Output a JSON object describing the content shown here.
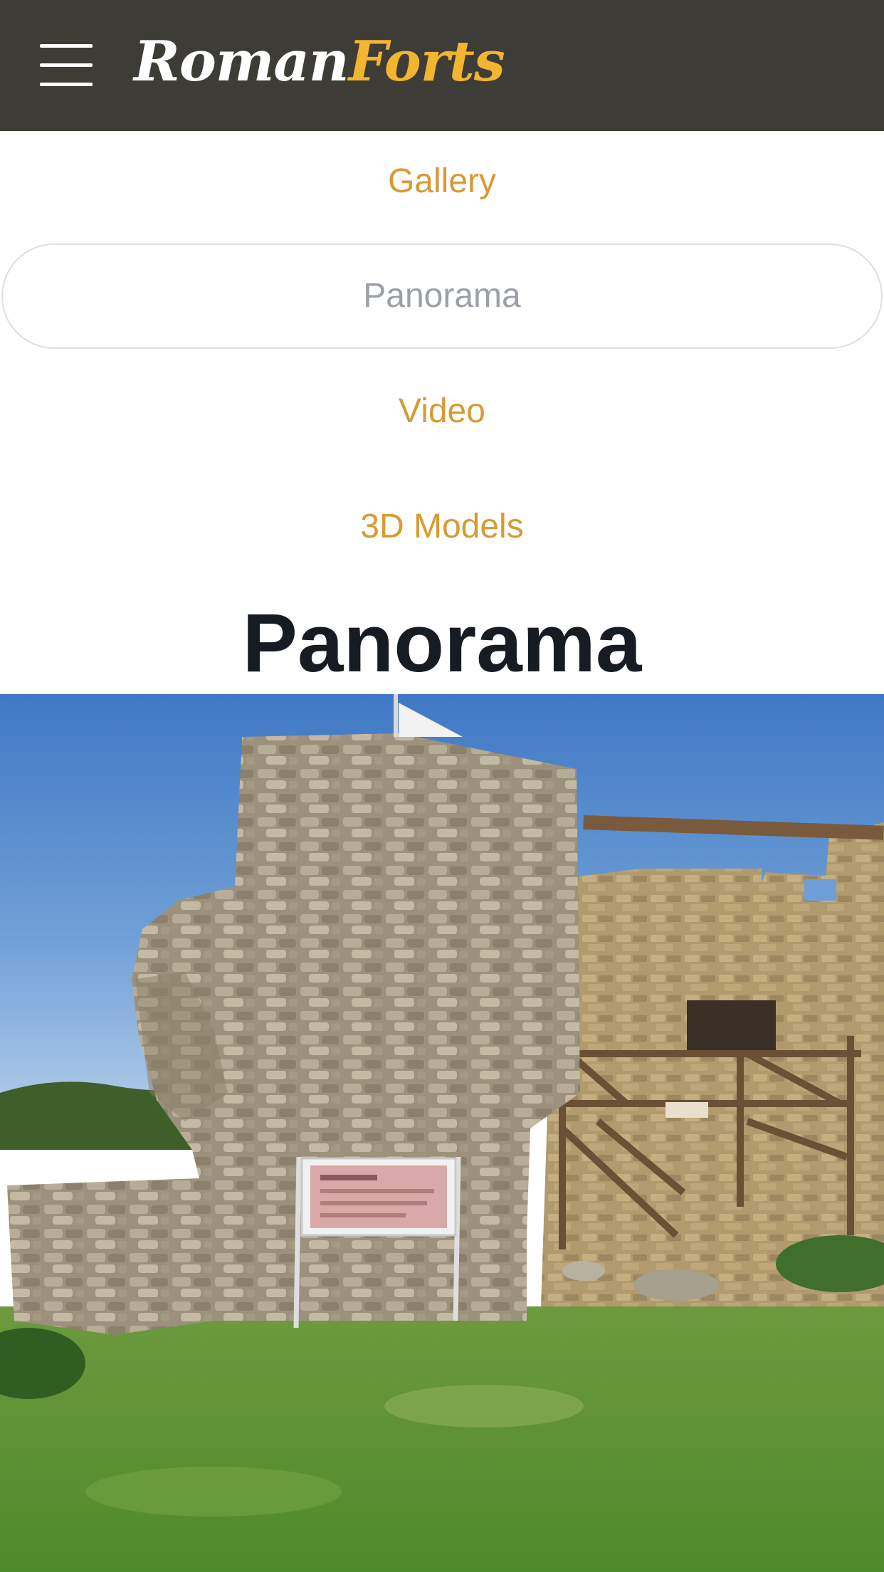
{
  "header": {
    "logo_part1": "Roman",
    "logo_part2": "Forts",
    "menu_icon": "hamburger-menu-icon"
  },
  "nav": {
    "items": [
      {
        "label": "Gallery"
      },
      {
        "label": "Panorama",
        "active": true
      },
      {
        "label": "Video"
      },
      {
        "label": "3D Models"
      }
    ]
  },
  "main": {
    "title": "Panorama"
  },
  "colors": {
    "header_bg": "#3e3c37",
    "accent": "#d79a35",
    "logo_accent": "#f2b530",
    "active_pill_text": "#9aa0a6",
    "title": "#161c22"
  }
}
